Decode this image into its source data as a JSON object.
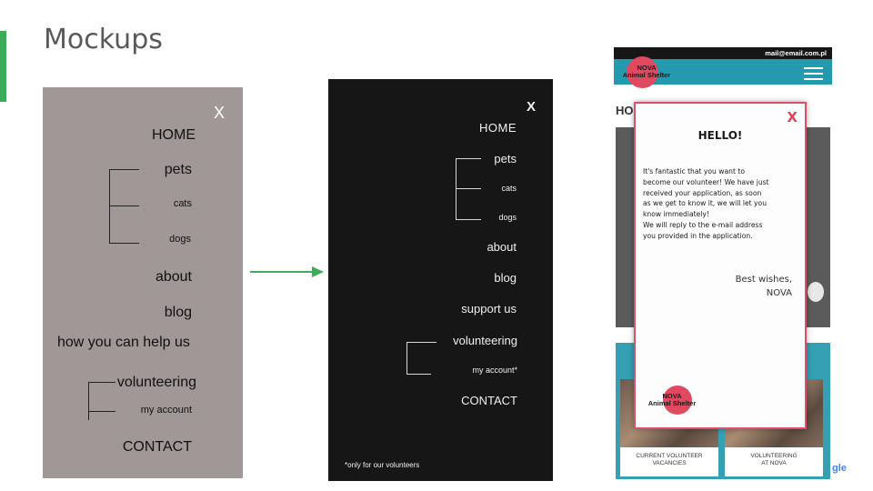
{
  "slide": {
    "title": "Mockups"
  },
  "mockup_gray": {
    "close": "X",
    "home": "HOME",
    "pets": "pets",
    "cats": "cats",
    "dogs": "dogs",
    "about": "about",
    "blog": "blog",
    "help": "how you can help us",
    "volunteering": "volunteering",
    "account": "my account",
    "contact": "CONTACT"
  },
  "mockup_dark": {
    "close": "X",
    "home": "HOME",
    "pets": "pets",
    "cats": "cats",
    "dogs": "dogs",
    "about": "about",
    "blog": "blog",
    "support": "support us",
    "volunteering": "volunteering",
    "account": "my account*",
    "contact": "CONTACT",
    "footnote": "*only for our volunteers"
  },
  "mockup_phone": {
    "email": "mail@email.com.pl",
    "logo_line1": "NOVA",
    "logo_line2": "Animal Shelter",
    "heading_partial": "HO",
    "modal": {
      "close": "X",
      "title": "HELLO!",
      "body": [
        "It's fantastic that you want to",
        "become our volunteer! We have just",
        "received your application, as soon",
        "as we get to know it, we will let you",
        "know immediately!",
        "We will reply to the e-mail address",
        "you provided in the application."
      ],
      "sign_1": "Best wishes,",
      "sign_2": "NOVA"
    },
    "cards": [
      {
        "line1": "CURRENT VOLUNTEER",
        "line2": "VACANCIES"
      },
      {
        "line1": "VOLUNTEERING",
        "line2": "AT NOVA"
      }
    ]
  },
  "colors": {
    "accent": "#3cab5a",
    "gray_panel": "#a09797",
    "dark_panel": "#161616",
    "nav_blue": "#239aae",
    "logo_red": "#e0495f"
  },
  "footer": {
    "partial_logo_text": "gle"
  }
}
